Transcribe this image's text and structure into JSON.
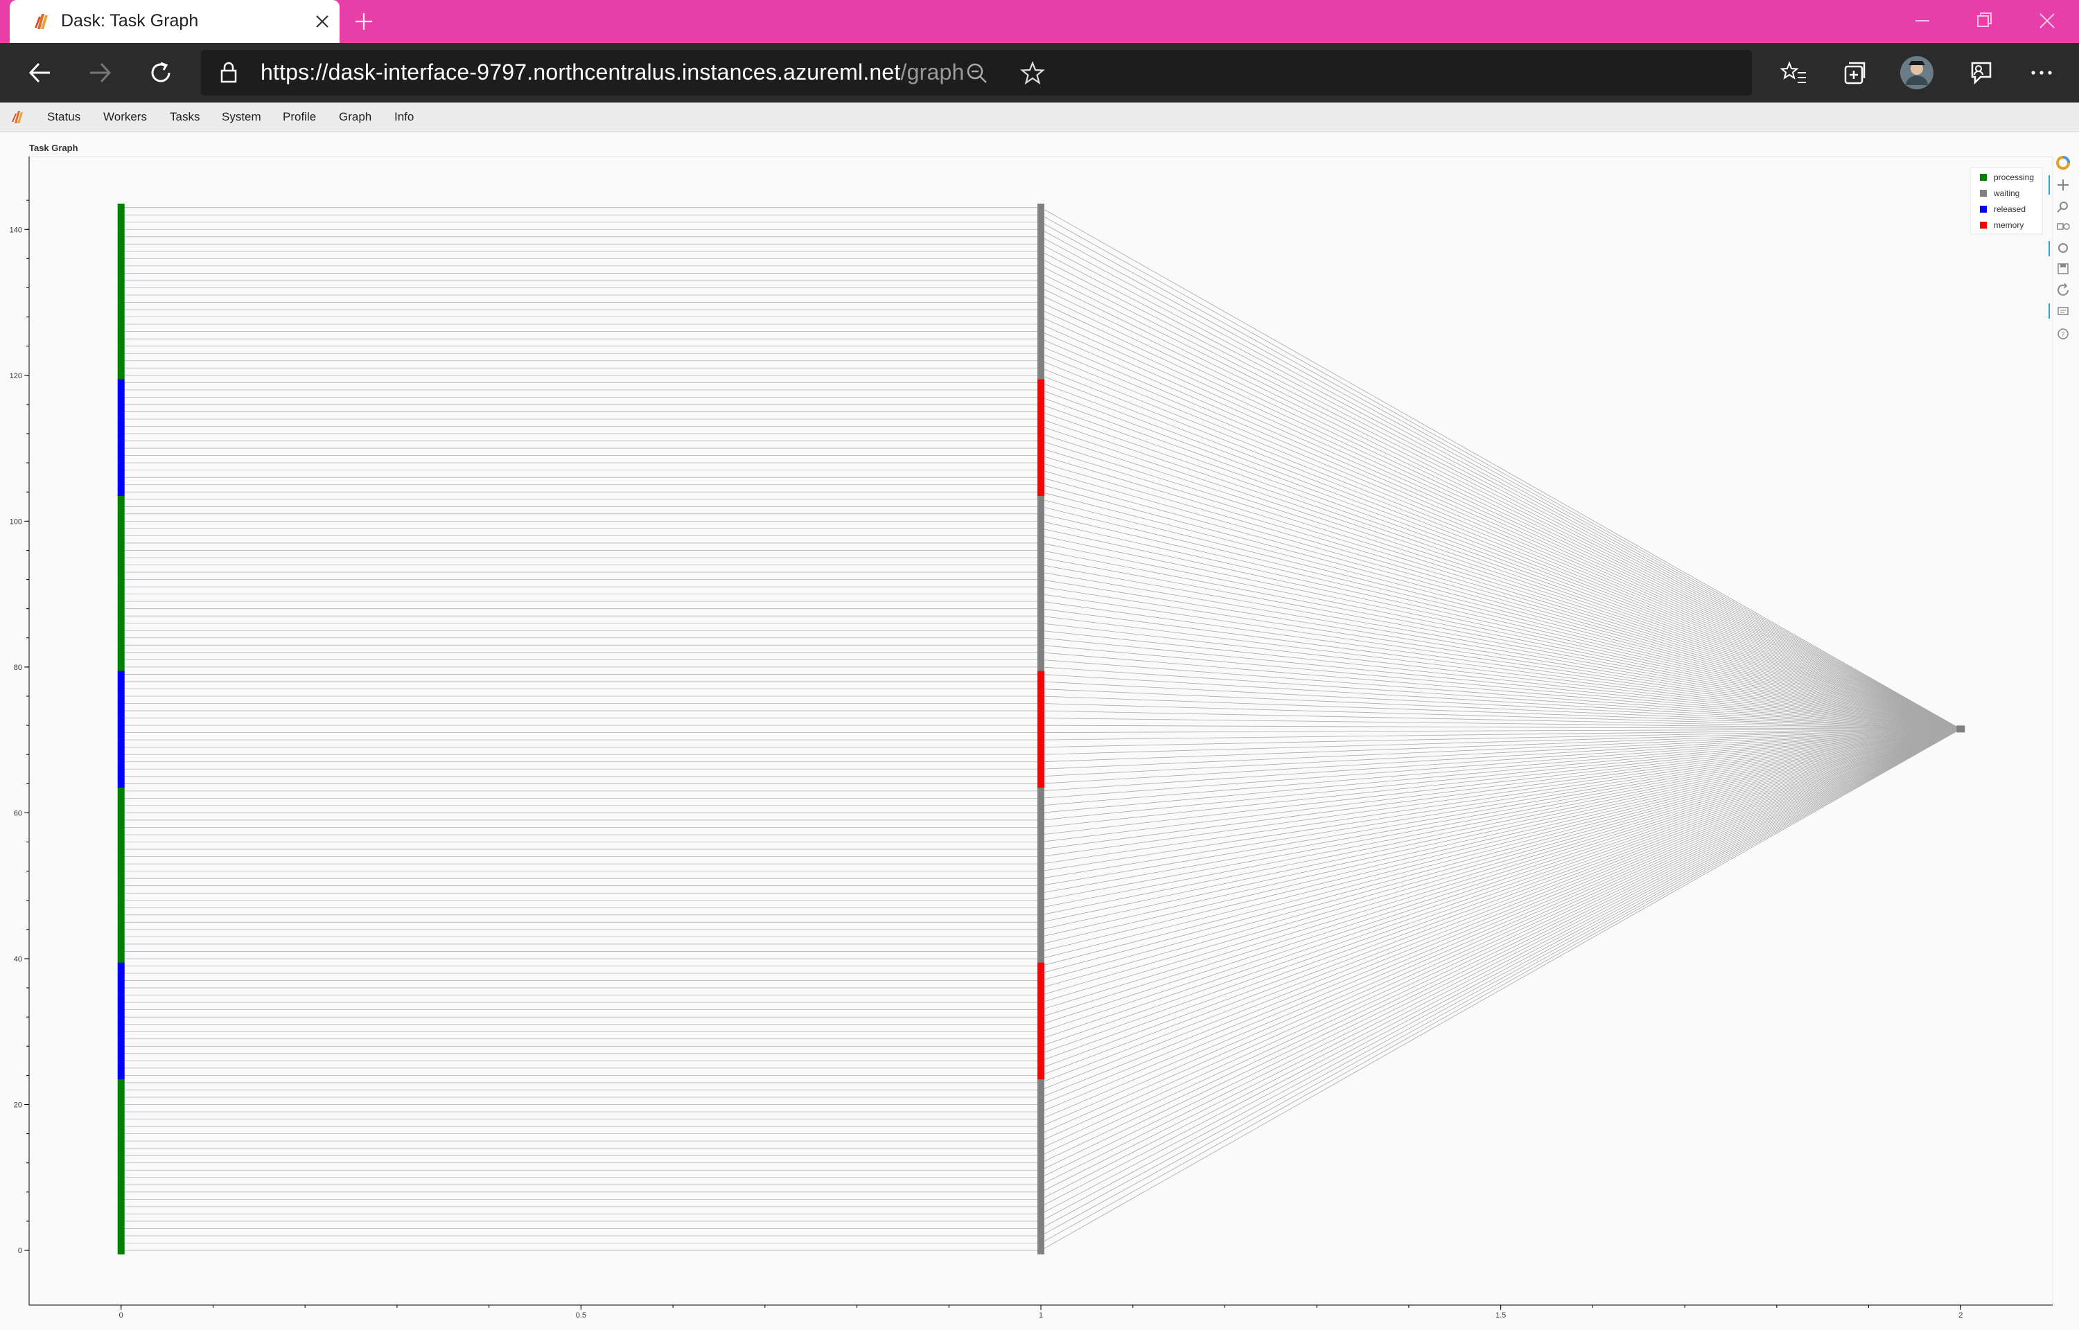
{
  "browser": {
    "tab_title": "Dask: Task Graph",
    "url_host": "https://dask-interface-9797.northcentralus.instances.azureml.net",
    "url_path": "/graph",
    "icons": [
      "back-icon",
      "forward-icon",
      "refresh-icon",
      "lock-icon",
      "zoom-out-icon",
      "favorite-star-icon",
      "favorites-icon",
      "collections-icon",
      "profile-avatar",
      "feedback-icon",
      "more-icon"
    ]
  },
  "nav": {
    "items": [
      "Status",
      "Workers",
      "Tasks",
      "System",
      "Profile",
      "Graph",
      "Info"
    ]
  },
  "chart_title": "Task Graph",
  "colors": {
    "processing": "#008000",
    "waiting": "#808080",
    "released": "#0000ff",
    "memory": "#ff0000",
    "titlebar": "#e83ea8"
  },
  "chart_data": {
    "type": "scatter",
    "title": "Task Graph",
    "xlabel": "",
    "ylabel": "",
    "xlim": [
      -0.1,
      2.1
    ],
    "ylim": [
      -7.5,
      150
    ],
    "x_ticks": [
      "0",
      "0.5",
      "1",
      "1.5",
      "2"
    ],
    "y_ticks": [
      "0",
      "20",
      "40",
      "60",
      "80",
      "100",
      "120",
      "140"
    ],
    "legend": [
      {
        "name": "processing",
        "color": "#008000"
      },
      {
        "name": "waiting",
        "color": "#808080"
      },
      {
        "name": "released",
        "color": "#0000ff"
      },
      {
        "name": "memory",
        "color": "#ff0000"
      }
    ],
    "legend_position": "top-right",
    "nodes_per_column": 144,
    "columns": [
      {
        "x": 0,
        "segments": [
          {
            "state": "processing",
            "from": 0,
            "to": 23
          },
          {
            "state": "released",
            "from": 24,
            "to": 39
          },
          {
            "state": "processing",
            "from": 40,
            "to": 63
          },
          {
            "state": "released",
            "from": 64,
            "to": 79
          },
          {
            "state": "processing",
            "from": 80,
            "to": 103
          },
          {
            "state": "released",
            "from": 104,
            "to": 119
          },
          {
            "state": "processing",
            "from": 120,
            "to": 143
          }
        ]
      },
      {
        "x": 1,
        "segments": [
          {
            "state": "waiting",
            "from": 0,
            "to": 23
          },
          {
            "state": "memory",
            "from": 24,
            "to": 39
          },
          {
            "state": "waiting",
            "from": 40,
            "to": 63
          },
          {
            "state": "memory",
            "from": 64,
            "to": 79
          },
          {
            "state": "waiting",
            "from": 80,
            "to": 103
          },
          {
            "state": "memory",
            "from": 104,
            "to": 119
          },
          {
            "state": "waiting",
            "from": 120,
            "to": 143
          }
        ]
      }
    ],
    "sink": {
      "x": 2,
      "y": 71.5,
      "state": "waiting"
    },
    "edges": "node i in column x=0 -> node i in column x=1; every node in column x=1 -> sink"
  }
}
